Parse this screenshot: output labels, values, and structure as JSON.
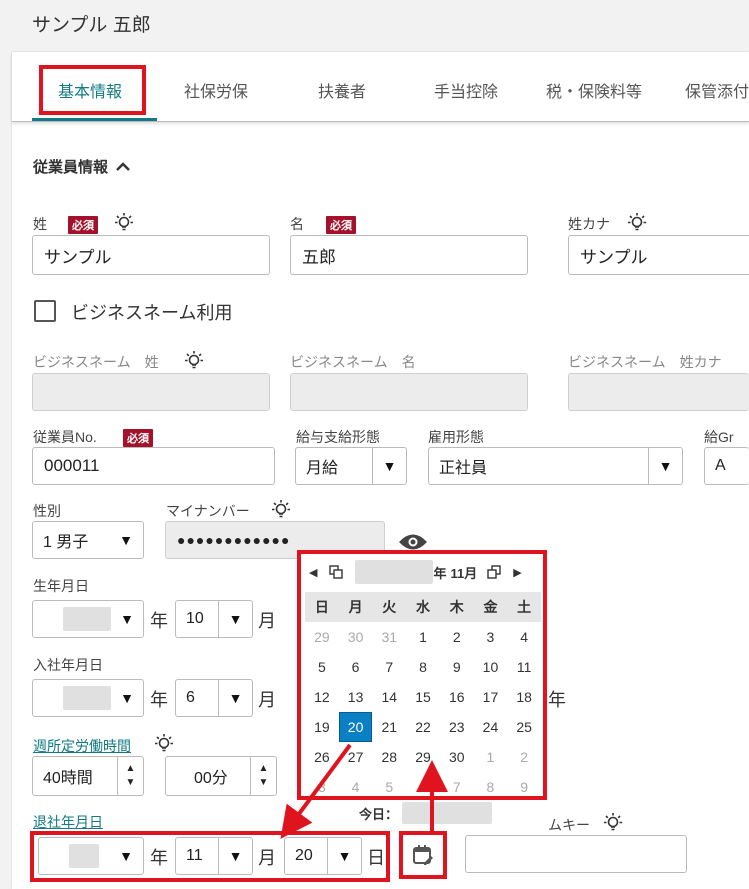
{
  "page_title": "サンプル 五郎",
  "tabs": [
    {
      "label": "基本情報",
      "active": true
    },
    {
      "label": "社保労保"
    },
    {
      "label": "扶養者"
    },
    {
      "label": "手当控除"
    },
    {
      "label": "税・保険料等"
    },
    {
      "label": "保管添付"
    }
  ],
  "section": {
    "title": "従業員情報",
    "chevron": "chevron-up-icon"
  },
  "required_badge": "必須",
  "fields": {
    "last_name": {
      "label": "姓",
      "value": "サンプル"
    },
    "first_name": {
      "label": "名",
      "value": "五郎"
    },
    "last_name_kana": {
      "label": "姓カナ",
      "value": "サンプル"
    },
    "business_name_checkbox": {
      "label": "ビジネスネーム利用",
      "checked": false
    },
    "biz_last": {
      "label": "ビジネスネーム　姓",
      "value": ""
    },
    "biz_first": {
      "label": "ビジネスネーム　名",
      "value": ""
    },
    "biz_kana": {
      "label": "ビジネスネーム　姓カナ",
      "value": ""
    },
    "employee_no": {
      "label": "従業員No.",
      "value": "000011"
    },
    "pay_type": {
      "label": "給与支給形態",
      "value": "月給"
    },
    "employment_type": {
      "label": "雇用形態",
      "value": "正社員"
    },
    "pay_group": {
      "label": "給Gr",
      "value": "A"
    },
    "gender": {
      "label": "性別",
      "value": "1 男子"
    },
    "my_number": {
      "label": "マイナンバー",
      "value": "●●●●●●●●●●●●"
    },
    "birth_date": {
      "label": "生年月日",
      "month": "10"
    },
    "hire_date": {
      "label": "入社年月日",
      "month": "6"
    },
    "weekly_hours": {
      "label": "週所定労働時間",
      "hours": "40時間",
      "minutes": "00分"
    },
    "retire_date": {
      "label": "退社年月日",
      "month": "11",
      "day": "20"
    },
    "search_key": {
      "label": "ムキー",
      "value": ""
    }
  },
  "units": {
    "year": "年",
    "month": "月",
    "day": "日"
  },
  "calendar": {
    "header_year_suffix": "年",
    "header_month": "11月",
    "weekdays": [
      "日",
      "月",
      "火",
      "水",
      "木",
      "金",
      "土"
    ],
    "weeks": [
      [
        "29",
        "30",
        "31",
        "1",
        "2",
        "3",
        "4"
      ],
      [
        "5",
        "6",
        "7",
        "8",
        "9",
        "10",
        "11"
      ],
      [
        "12",
        "13",
        "14",
        "15",
        "16",
        "17",
        "18"
      ],
      [
        "19",
        "20",
        "21",
        "22",
        "23",
        "24",
        "25"
      ],
      [
        "26",
        "27",
        "28",
        "29",
        "30",
        "1",
        "2"
      ],
      [
        "3",
        "4",
        "5",
        "6",
        "7",
        "8",
        "9"
      ]
    ],
    "selected": "20",
    "today_label": "今日：",
    "accent_color": "#0a7fc4"
  },
  "colors": {
    "accent": "#117a82",
    "highlight": "#e0141e",
    "badge": "#a3122a"
  }
}
